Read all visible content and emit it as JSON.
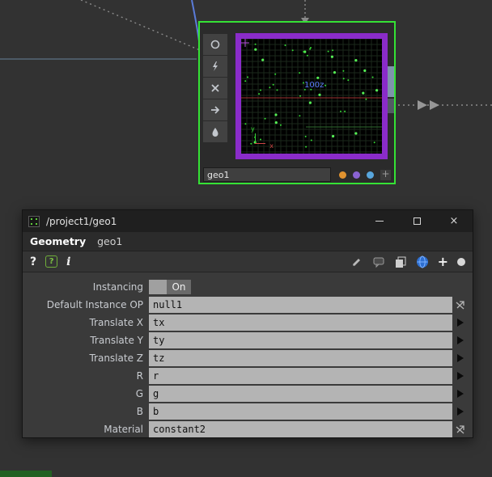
{
  "network_editor": {
    "node": {
      "name": "geo1",
      "viewer_overlay_label": "100z",
      "axis_labels": {
        "x": "x",
        "y": "y"
      },
      "add_dot_label": "+",
      "palette_dots": [
        "#e0922f",
        "#8a63d2",
        "#58a6dd"
      ]
    },
    "colors": {
      "selection": "#35e235",
      "viewer_frame": "#8a2cc9"
    }
  },
  "param_window": {
    "titlebar": {
      "title": "/project1/geo1",
      "close_glyph": "×"
    },
    "header": {
      "op_family": "Geometry",
      "op_name": "geo1"
    },
    "toolbar": {
      "help": "?",
      "lang_help": "?",
      "info": "i",
      "plus": "+"
    },
    "parameters": [
      {
        "label": "Instancing",
        "type": "toggle",
        "value": "On"
      },
      {
        "label": "Default Instance OP",
        "type": "text",
        "value": "null1",
        "action": "op-pick"
      },
      {
        "label": "Translate X",
        "type": "text",
        "value": "tx",
        "action": "expand"
      },
      {
        "label": "Translate Y",
        "type": "text",
        "value": "ty",
        "action": "expand"
      },
      {
        "label": "Translate Z",
        "type": "text",
        "value": "tz",
        "action": "expand"
      },
      {
        "label": "R",
        "type": "text",
        "value": "r",
        "action": "expand"
      },
      {
        "label": "G",
        "type": "text",
        "value": "g",
        "action": "expand"
      },
      {
        "label": "B",
        "type": "text",
        "value": "b",
        "action": "expand"
      }
    ],
    "parameters_last": {
      "label": "Material",
      "type": "text",
      "value": "constant2",
      "action": "op-pick"
    }
  }
}
